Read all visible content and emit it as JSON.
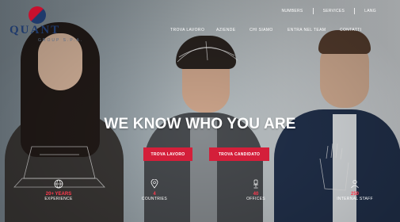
{
  "logo": {
    "name": "QUANT",
    "tagline": "GROUP S.P.A."
  },
  "utility_nav": [
    "NUMBERS",
    "SERVICES",
    "LANG"
  ],
  "main_nav": [
    "TROVA LAVORO",
    "AZIENDE",
    "CHI SIAMO",
    "ENTRA NEL TEAM",
    "CONTATTI"
  ],
  "hero": {
    "headline": "WE KNOW WHO YOU ARE",
    "button_primary": "TROVA LAVORO",
    "button_secondary": "TROVA CANDIDATO"
  },
  "stats": [
    {
      "icon": "globe-icon",
      "number": "20+ YEARS",
      "label": "EXPERIENCE"
    },
    {
      "icon": "location-pin-icon",
      "number": "4",
      "label": "COUNTRIES"
    },
    {
      "icon": "office-chair-icon",
      "number": "40",
      "label": "OFFICES"
    },
    {
      "icon": "staff-icon",
      "number": "250",
      "label": "INTERNAL STAFF"
    }
  ],
  "colors": {
    "accent": "#d41f3a",
    "brand_navy": "#1f3a6b",
    "stat_number": "#ff3a4e"
  }
}
